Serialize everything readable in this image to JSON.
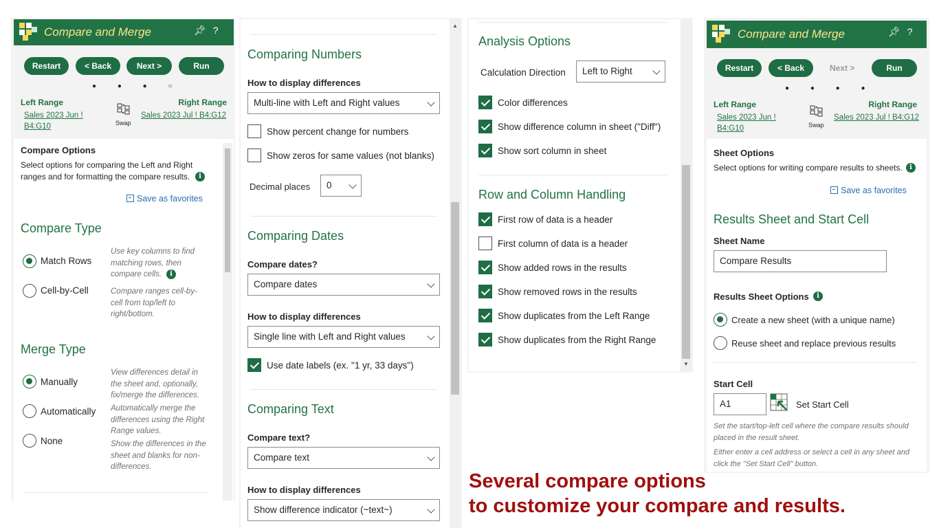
{
  "app": {
    "title": "Compare and Merge",
    "pin_icon": "pin-icon",
    "help_label": "?"
  },
  "nav": {
    "restart": "Restart",
    "back": "< Back",
    "next": "Next >",
    "run": "Run",
    "steps_p1": "● ● ● ○",
    "steps_p4": "● ● ● ●"
  },
  "ranges": {
    "left_header": "Left Range",
    "right_header": "Right Range",
    "left_value": "Sales 2023 Jun ! B4:G10",
    "right_value": "Sales 2023 Jul ! B4:G12",
    "swap_label": "Swap"
  },
  "panel1": {
    "options_title": "Compare Options",
    "options_desc": "Select options for comparing the Left and Right ranges and for formatting the compare results.",
    "save_favorites": "Save as favorites",
    "compare_type_title": "Compare Type",
    "match_rows": "Match Rows",
    "match_rows_hint": "Use key columns to find matching rows, then compare cells.",
    "cell_by_cell": "Cell-by-Cell",
    "cell_by_cell_hint": "Compare ranges cell-by-cell from top/left to right/bottom.",
    "merge_type_title": "Merge Type",
    "manually": "Manually",
    "manually_hint": "View differences detail in the sheet and, optionally, fix/merge the differences.",
    "automatically": "Automatically",
    "automatically_hint": "Automatically merge the differences using the Right Range values.",
    "none": "None",
    "none_hint": "Show the differences in the sheet and blanks for non-differences."
  },
  "panel2": {
    "numbers_title": "Comparing Numbers",
    "how_display": "How to display differences",
    "numbers_display_value": "Multi-line with Left and Right values",
    "show_percent": "Show percent change for numbers",
    "show_zeros": "Show zeros for same values (not blanks)",
    "decimal_places": "Decimal places",
    "decimal_value": "0",
    "dates_title": "Comparing Dates",
    "compare_dates_q": "Compare dates?",
    "compare_dates_value": "Compare dates",
    "dates_display_value": "Single line with Left and Right values",
    "use_date_labels": "Use date labels (ex. \"1 yr, 33 days\")",
    "text_title": "Comparing Text",
    "compare_text_q": "Compare text?",
    "compare_text_value": "Compare text",
    "text_display_value": "Show difference indicator (~text~)"
  },
  "panel3": {
    "analysis_title": "Analysis Options",
    "calc_direction": "Calculation Direction",
    "calc_direction_value": "Left to Right",
    "color_differences": "Color differences",
    "show_diff_column": "Show difference column in sheet (\"Diff\")",
    "show_sort_column": "Show sort column in sheet",
    "rowcol_title": "Row and Column Handling",
    "first_row_header": "First row of data is a header",
    "first_col_header": "First column of data is a header",
    "show_added_rows": "Show added rows in the results",
    "show_removed_rows": "Show removed rows in the results",
    "dups_left": "Show duplicates from the Left Range",
    "dups_right": "Show duplicates from the Right Range"
  },
  "panel4": {
    "sheet_options_title": "Sheet Options",
    "sheet_options_desc": "Select options for writing compare results to sheets.",
    "save_favorites": "Save as favorites",
    "results_title": "Results Sheet and Start Cell",
    "sheet_name_label": "Sheet Name",
    "sheet_name_value": "Compare Results",
    "results_options_label": "Results Sheet Options",
    "create_new": "Create a new sheet (with a unique name)",
    "reuse_sheet": "Reuse sheet and replace previous results",
    "start_cell_label": "Start Cell",
    "start_cell_value": "A1",
    "set_start_cell": "Set Start Cell",
    "start_hint1": "Set the start/top-left cell where the compare results should placed in the result sheet.",
    "start_hint2": "Either enter a cell address or select a cell in any sheet and click the \"Set Start Cell\" button."
  },
  "caption": {
    "line1": "Several compare options",
    "line2": "to customize your compare and results."
  },
  "colors": {
    "brand_green": "#217346",
    "button_green": "#1f6d45",
    "title_yellow": "#ffe48a",
    "caption_red": "#a10f0f",
    "link_blue": "#2b6cb0"
  }
}
